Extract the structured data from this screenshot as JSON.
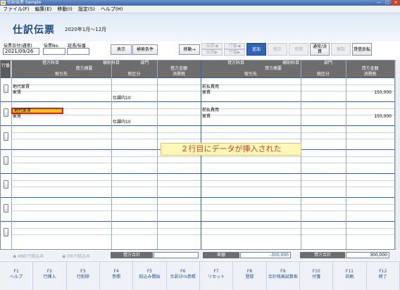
{
  "window": {
    "title": "仕訳伝票 Sample",
    "min": "—",
    "max": "□",
    "close": "×"
  },
  "menu": [
    "ファイル(F)",
    "編集(E)",
    "移動(I)",
    "設定(S)",
    "ヘルプ(H)"
  ],
  "page": {
    "title": "仕訳伝票",
    "period": "2020年1月～12月"
  },
  "fields": {
    "date_label": "伝票日付(通常)",
    "date": "2021/09/26",
    "no_label": "伝票No.",
    "no": "",
    "cert_label": "証憑/伝番",
    "cert": ""
  },
  "buttons": {
    "display": "表示",
    "search": "検索条件",
    "move": "移動→",
    "prev_slip": "伝票◀",
    "next_slip": "伝票▶",
    "prev_row": "行番◀",
    "next_row": "行番▶",
    "add": "追加",
    "modify": "修正",
    "refer": "参照",
    "normal": "通常/決算",
    "copy": "複製",
    "reverse": "貸借反転"
  },
  "grid": {
    "row_no": "行番",
    "headers1": [
      "借方科目",
      "補助科目",
      "部門",
      "",
      "貸方科目",
      "補助科目",
      "部門",
      ""
    ],
    "headers2": [
      "借方摘要",
      "借方金額",
      "貸方摘要",
      "貸方金額"
    ],
    "headers3": [
      "取引先",
      "税区分",
      "消費税",
      "取引先",
      "税区分",
      "消費税"
    ],
    "rows": [
      {
        "dr_account": "地代家賃",
        "dr_memo": "家賃",
        "dr_tax": "仕課内10",
        "cr_account": "前払費用",
        "cr_memo": "家賃",
        "cr_amount": "150,000"
      },
      {
        "dr_account": "地代家賃",
        "dr_memo": "家賃",
        "dr_tax": "仕課内10",
        "cr_account": "前払費用",
        "cr_memo": "家賃",
        "cr_amount": "150,000"
      }
    ],
    "notice": "２行目にデータが挿入された"
  },
  "footer": {
    "and_label": "ANDで絞込み",
    "or_label": "ORで絞込み",
    "dr_total_label": "借方合計",
    "dr_total": "",
    "diff_label": "差額",
    "diff": "-300,000",
    "cr_total_label": "貸方合計",
    "cr_total": "300,000"
  },
  "fkeys": [
    {
      "k": "F1",
      "l": "ヘルプ"
    },
    {
      "k": "F2",
      "l": "行挿入"
    },
    {
      "k": "F3",
      "l": "行削除"
    },
    {
      "k": "F4",
      "l": "参照"
    },
    {
      "k": "F5",
      "l": "絞込み開始"
    },
    {
      "k": "F6",
      "l": "仕訳ｽﾀｲﾙ参照"
    },
    {
      "k": "F7",
      "l": "リセット"
    },
    {
      "k": "F8",
      "l": "登録"
    },
    {
      "k": "F9",
      "l": "合計残高試算表"
    },
    {
      "k": "F10",
      "l": "付箋"
    },
    {
      "k": "F11",
      "l": "印刷"
    },
    {
      "k": "F12",
      "l": "終了"
    }
  ]
}
